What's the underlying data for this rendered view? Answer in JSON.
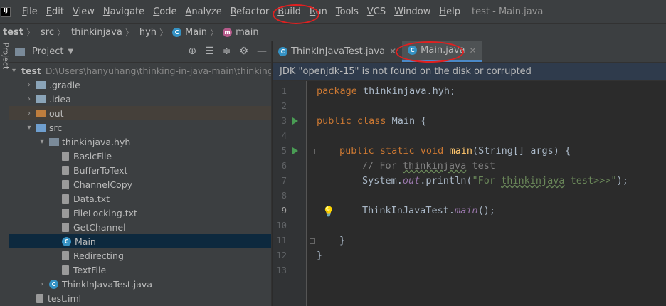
{
  "menubar": {
    "logo_text": "IJ",
    "items": [
      "File",
      "Edit",
      "View",
      "Navigate",
      "Code",
      "Analyze",
      "Refactor",
      "Build",
      "Run",
      "Tools",
      "VCS",
      "Window",
      "Help"
    ],
    "window_title": "test - Main.java"
  },
  "breadcrumb": [
    "test",
    "src",
    "thinkinjava",
    "hyh",
    "Main",
    "main"
  ],
  "project_panel": {
    "title": "Project",
    "stripe_label": "Project",
    "tree": [
      {
        "label": "test",
        "extra": "D:\\Users\\hanyuhang\\thinking-in-java-main\\thinking",
        "icon": "folder-icon",
        "arrow": "▾",
        "indent": 0
      },
      {
        "label": ".gradle",
        "icon": "folder-icon",
        "arrow": "›",
        "indent": 1
      },
      {
        "label": ".idea",
        "icon": "folder-icon",
        "arrow": "›",
        "indent": 1
      },
      {
        "label": "out",
        "icon": "folder-icon",
        "arrow": "›",
        "indent": 1,
        "highlight": true
      },
      {
        "label": "src",
        "icon": "folder-icon",
        "arrow": "▾",
        "indent": 1
      },
      {
        "label": "thinkinjava.hyh",
        "icon": "package-icon",
        "arrow": "▾",
        "indent": 2
      },
      {
        "label": "BasicFile",
        "icon": "file-icon",
        "indent": 3
      },
      {
        "label": "BufferToText",
        "icon": "file-icon",
        "indent": 3
      },
      {
        "label": "ChannelCopy",
        "icon": "file-icon",
        "indent": 3
      },
      {
        "label": "Data.txt",
        "icon": "file-icon",
        "indent": 3
      },
      {
        "label": "FileLocking.txt",
        "icon": "file-icon",
        "indent": 3
      },
      {
        "label": "GetChannel",
        "icon": "file-icon",
        "indent": 3
      },
      {
        "label": "Main",
        "icon": "class-icon",
        "indent": 3,
        "selected": true
      },
      {
        "label": "Redirecting",
        "icon": "file-icon",
        "indent": 3
      },
      {
        "label": "TextFile",
        "icon": "file-icon",
        "indent": 3
      },
      {
        "label": "ThinkInJavaTest.java",
        "icon": "class-icon",
        "arrow": "›",
        "indent": 2
      },
      {
        "label": "test.iml",
        "icon": "file-icon",
        "indent": 1
      }
    ]
  },
  "editor": {
    "tabs": [
      {
        "label": "ThinkInJavaTest.java",
        "active": false
      },
      {
        "label": "Main.java",
        "active": true
      }
    ],
    "notice": "JDK \"openjdk-15\" is not found on the disk or corrupted",
    "line_numbers": [
      "1",
      "2",
      "3",
      "4",
      "5",
      "6",
      "7",
      "8",
      "9",
      "10",
      "11",
      "12",
      "13"
    ],
    "code": {
      "l1_kw": "package",
      "l1_rest": " thinkinjava.hyh;",
      "l3_kw": "public class",
      "l3_rest": " Main {",
      "l5_kw": "public static void",
      "l5_fn": "main",
      "l5_rest": "(String[] args) {",
      "l6_comment_pre": "// For ",
      "l6_comment_word": "thinkinjava",
      "l6_comment_post": " test",
      "l7_pre": "System.",
      "l7_field": "out",
      "l7_mid": ".println(",
      "l7_str_pre": "\"For ",
      "l7_str_word": "thinkinjava",
      "l7_str_post": " test>>>\"",
      "l7_end": ");",
      "l9_pre": "ThinkInJavaTest.",
      "l9_method": "main",
      "l9_end": "();",
      "l11": "}",
      "l12": "}"
    }
  }
}
